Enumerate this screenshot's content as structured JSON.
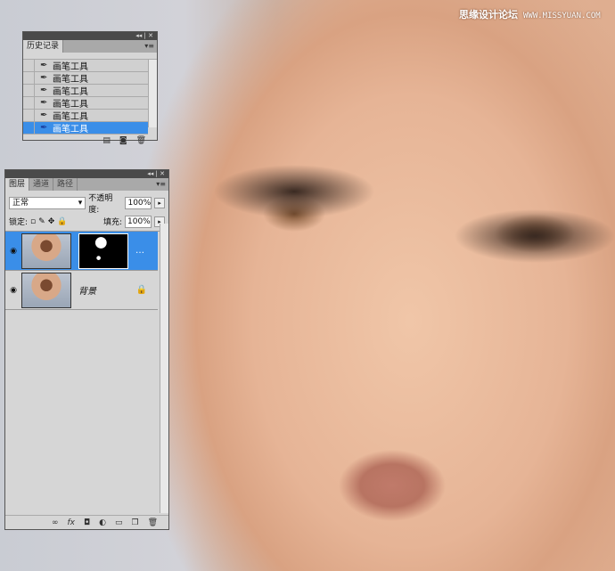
{
  "watermark": {
    "text": "思缘设计论坛",
    "url": "WWW.MISSYUAN.COM"
  },
  "history_panel": {
    "tab": "历史记录",
    "items": [
      "画笔工具",
      "画笔工具",
      "画笔工具",
      "画笔工具",
      "画笔工具",
      "画笔工具"
    ],
    "selected_index": 5
  },
  "layers_panel": {
    "tabs": [
      "图层",
      "通道",
      "路径"
    ],
    "blend_mode": "正常",
    "opacity_label": "不透明度:",
    "opacity": "100%",
    "lock_label": "锁定:",
    "fill_label": "填充:",
    "fill": "100%",
    "layers": [
      {
        "name": "",
        "has_mask": true,
        "selected": true
      },
      {
        "name": "背景",
        "locked": true,
        "selected": false
      }
    ],
    "footer_icons": [
      "link-icon",
      "fx-icon",
      "mask-icon",
      "adjustment-icon",
      "group-icon",
      "new-layer-icon",
      "trash-icon"
    ]
  },
  "colors": {
    "selection": "#3a8ee8",
    "panel": "#d6d6d6"
  }
}
